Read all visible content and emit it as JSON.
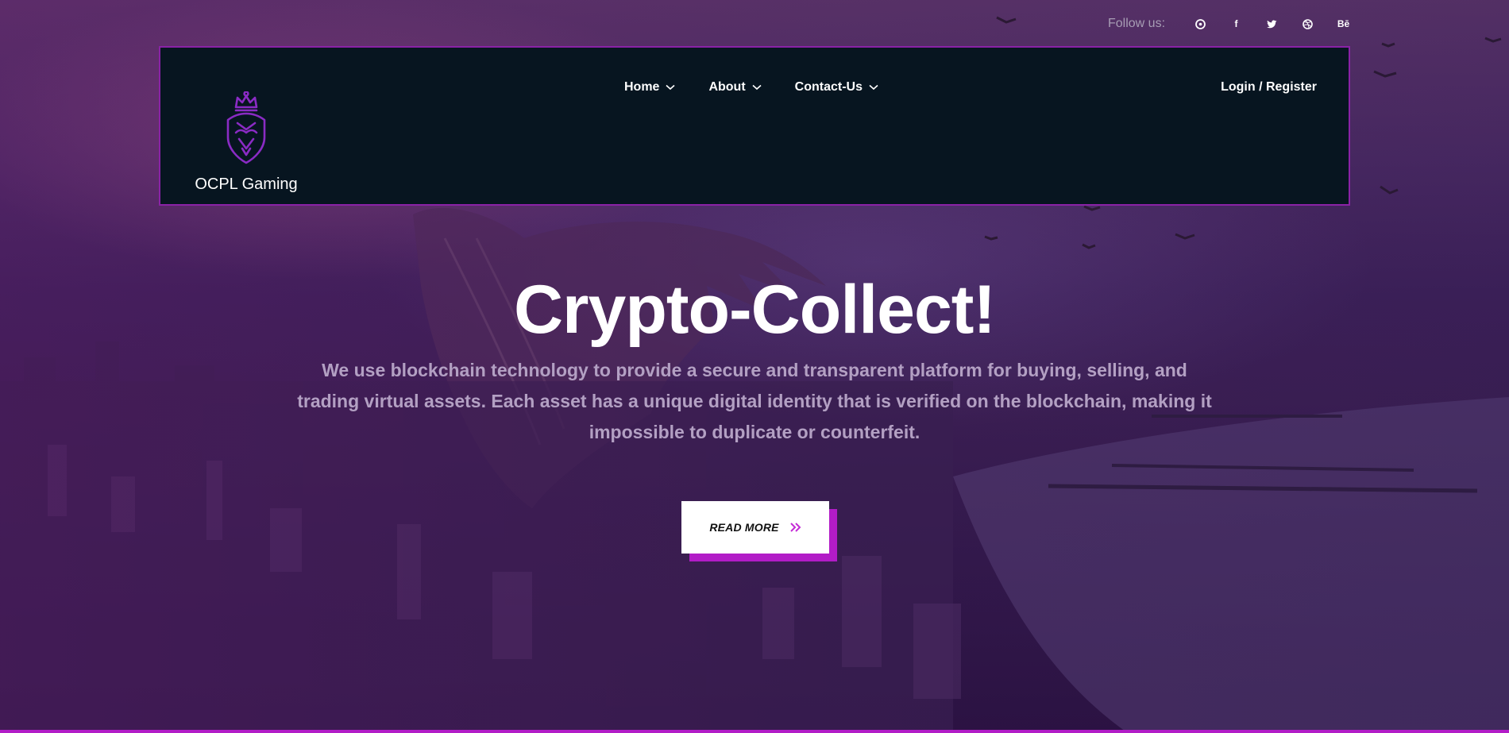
{
  "social": {
    "follow_label": "Follow us:",
    "icons": [
      {
        "name": "pinterest-icon",
        "glyph": "℗"
      },
      {
        "name": "facebook-icon",
        "glyph": "f"
      },
      {
        "name": "twitter-icon",
        "glyph": "🐦"
      },
      {
        "name": "dribbble-icon",
        "glyph": "◎"
      },
      {
        "name": "behance-icon",
        "glyph": "Bē"
      }
    ]
  },
  "navbar": {
    "brand_name": "OCPL Gaming",
    "menu": [
      {
        "label": "Home"
      },
      {
        "label": "About"
      },
      {
        "label": "Contact-Us"
      }
    ],
    "login_label": "Login / Register"
  },
  "hero": {
    "title": "Crypto-Collect!",
    "description": "We use blockchain technology to provide a secure and transparent platform for buying, selling, and trading virtual assets. Each asset has a unique digital identity that is verified on the blockchain, making it impossible to duplicate or counterfeit.",
    "cta_label": "READ MORE"
  },
  "colors": {
    "accent": "#b21cc7",
    "navbar_bg": "#071520",
    "logo": "#8a2bc4"
  }
}
